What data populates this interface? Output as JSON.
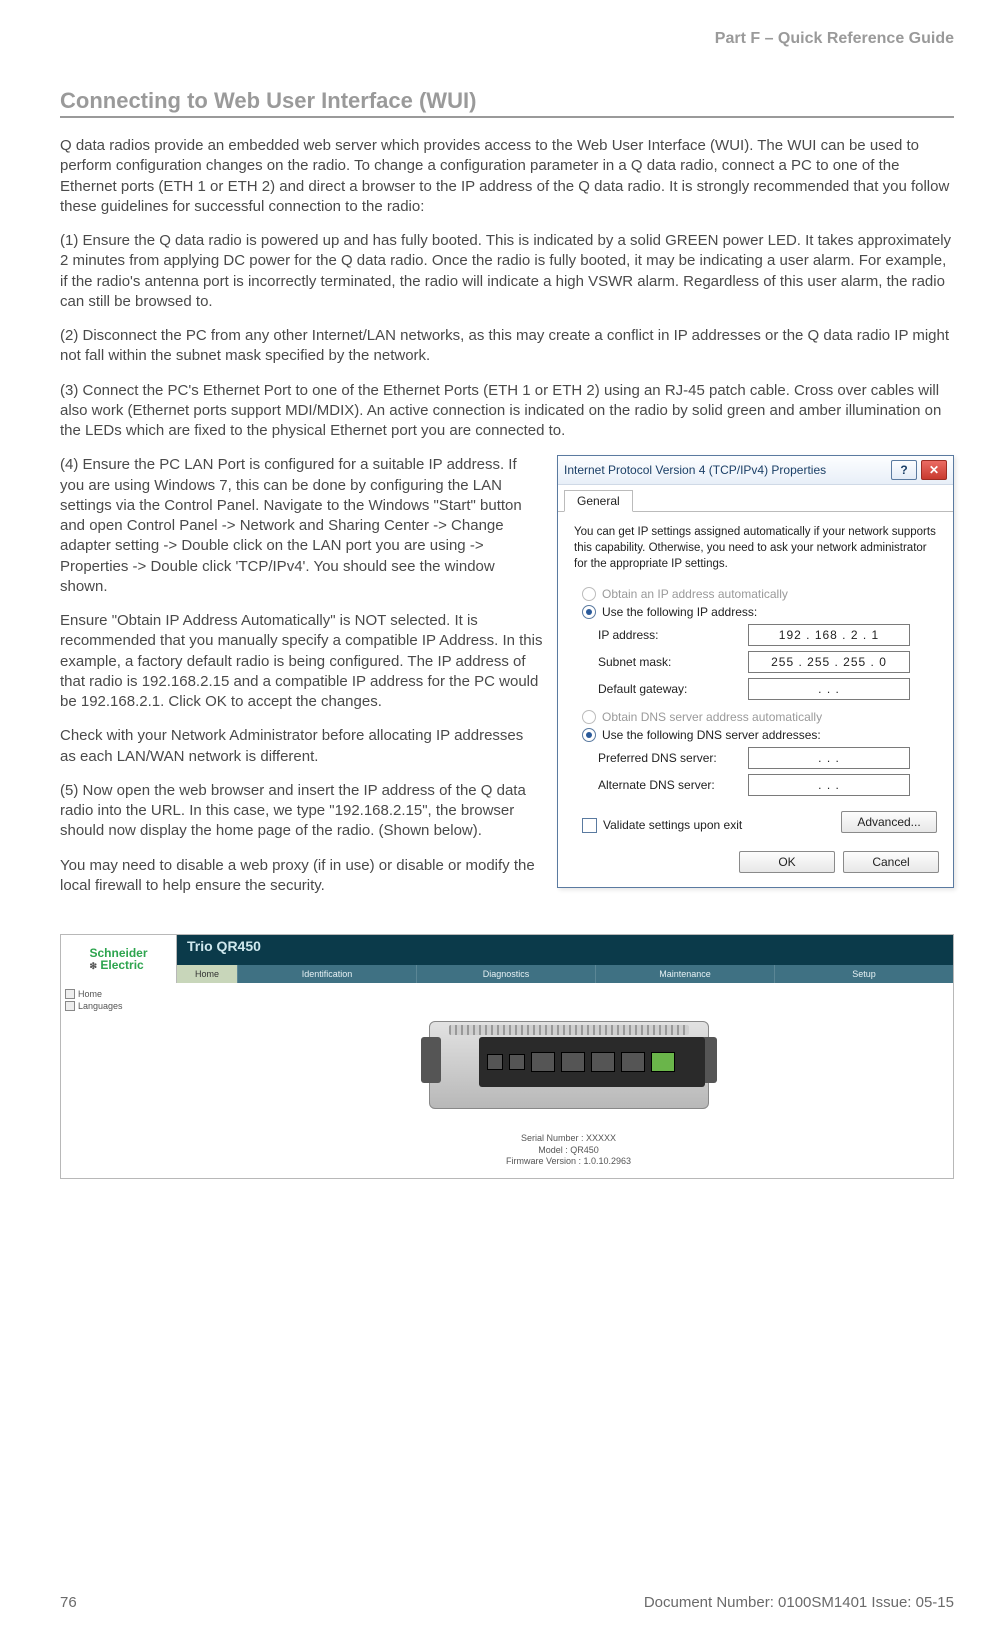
{
  "header": {
    "part": "Part F – Quick Reference Guide"
  },
  "section_title": "Connecting to Web User Interface (WUI)",
  "p_intro": "Q data radios provide an embedded web server which provides access to the Web User Interface (WUI). The WUI can be used to perform configuration changes on the radio. To change a configuration parameter in a Q data radio, connect a PC to one of the Ethernet ports (ETH 1 or ETH 2) and direct a browser to the IP address of the Q data radio. It is strongly recommended that you follow these guidelines for successful connection to the radio:",
  "p_step1": "(1) Ensure the Q data radio is powered up and has fully booted. This is indicated by a solid GREEN power LED. It takes approximately 2 minutes from applying DC power for the Q data radio. Once the radio is fully booted, it may be indicating a user alarm. For example, if the radio's antenna port is incorrectly terminated, the radio will indicate a high VSWR alarm. Regardless of this user alarm, the radio can still be browsed to.",
  "p_step2": "(2) Disconnect the PC from any other Internet/LAN networks, as this may create a conflict in IP addresses or the Q data radio IP might not fall within the subnet mask specified by the network.",
  "p_step3": "(3) Connect the PC's Ethernet Port to one of the Ethernet Ports (ETH 1 or ETH 2) using an RJ-45 patch cable. Cross over cables will also work (Ethernet ports support MDI/MDIX). An active connection is indicated on the radio by solid green and amber illumination on the LEDs which are fixed to the physical Ethernet port you are connected to.",
  "p_step4a": "(4) Ensure the PC LAN Port is configured for a suitable IP address. If you are using Windows 7, this can be done by configuring the LAN settings via the Control Panel. Navigate to the Windows \"Start\" button and open Control Panel -> Network and Sharing Center -> Change adapter setting -> Double click on the LAN port you are using -> Properties -> Double click 'TCP/IPv4'. You should see the window shown.",
  "p_step4b": "Ensure \"Obtain IP Address Automatically\" is NOT selected. It is recommended that you manually specify a compatible IP Address. In this example, a factory default radio is being configured. The IP address of that radio is 192.168.2.15 and a compatible IP address for the PC would be 192.168.2.1. Click OK to accept the changes.",
  "p_step4c": "Check with your Network Administrator before allocating IP addresses as each LAN/WAN network is different.",
  "p_step5": "(5) Now open the web browser and insert the IP address of the Q data radio into the URL. In this case, we type \"192.168.2.15\", the browser should now display the home page of the radio. (Shown below).",
  "p_proxy": "You may need to disable a web proxy (if in use) or disable or modify the local firewall to help ensure the security.",
  "dialog": {
    "title": "Internet Protocol Version 4 (TCP/IPv4) Properties",
    "help_btn": "?",
    "close_btn": "✕",
    "tab": "General",
    "info": "You can get IP settings assigned automatically if your network supports this capability. Otherwise, you need to ask your network administrator for the appropriate IP settings.",
    "r_obtain_ip": "Obtain an IP address automatically",
    "r_use_ip": "Use the following IP address:",
    "lbl_ip": "IP address:",
    "val_ip": "192 . 168 .  2  .  1",
    "lbl_mask": "Subnet mask:",
    "val_mask": "255 . 255 . 255 .  0",
    "lbl_gw": "Default gateway:",
    "val_gw": ".       .       .",
    "r_obtain_dns": "Obtain DNS server address automatically",
    "r_use_dns": "Use the following DNS server addresses:",
    "lbl_pdns": "Preferred DNS server:",
    "val_pdns": ".       .       .",
    "lbl_adns": "Alternate DNS server:",
    "val_adns": ".       .       .",
    "chk_validate": "Validate settings upon exit",
    "btn_advanced": "Advanced...",
    "btn_ok": "OK",
    "btn_cancel": "Cancel"
  },
  "wui": {
    "logo_top": "Schneider",
    "logo_bottom": "Electric",
    "product": "Trio QR450",
    "nav": [
      "Home",
      "Identification",
      "Diagnostics",
      "Maintenance",
      "Setup"
    ],
    "side": [
      "Home",
      "Languages"
    ],
    "meta1": "Serial Number : XXXXX",
    "meta2": "Model : QR450",
    "meta3": "Firmware Version : 1.0.10.2963"
  },
  "footer": {
    "page": "76",
    "doc": "Document Number: 0100SM1401   Issue: 05-15"
  }
}
